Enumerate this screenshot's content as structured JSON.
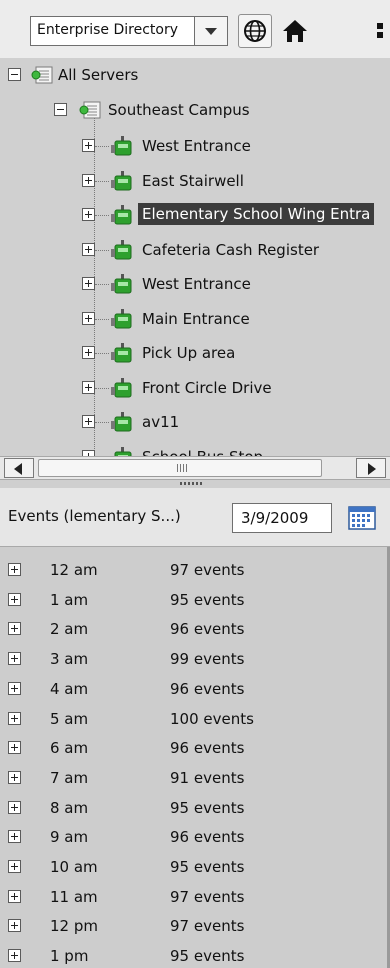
{
  "toolbar": {
    "directory_value": "Enterprise Directory",
    "icons": [
      "globe-icon",
      "home-icon",
      "grid-icon"
    ]
  },
  "tree": {
    "root": {
      "label": "All Servers",
      "icon": "server-group-icon",
      "expanded": true
    },
    "site": {
      "label": "Southeast Campus",
      "icon": "server-icon",
      "expanded": true
    },
    "cameras": [
      {
        "label": "West Entrance",
        "selected": false
      },
      {
        "label": "East Stairwell",
        "selected": false
      },
      {
        "label": "Elementary School Wing Entra",
        "selected": true
      },
      {
        "label": "Cafeteria Cash Register",
        "selected": false
      },
      {
        "label": "West Entrance",
        "selected": false
      },
      {
        "label": "Main Entrance",
        "selected": false
      },
      {
        "label": "Pick Up area",
        "selected": false
      },
      {
        "label": "Front Circle Drive",
        "selected": false
      },
      {
        "label": "av11",
        "selected": false
      },
      {
        "label": "School Bus Stop",
        "selected": false
      }
    ]
  },
  "events": {
    "title": "Events (lementary S...)",
    "date": "3/9/2009",
    "rows": [
      {
        "time": "12 am",
        "count": "97 events"
      },
      {
        "time": "1 am",
        "count": "95 events"
      },
      {
        "time": "2 am",
        "count": "96 events"
      },
      {
        "time": "3 am",
        "count": "99 events"
      },
      {
        "time": "4 am",
        "count": "96 events"
      },
      {
        "time": "5 am",
        "count": "100 events"
      },
      {
        "time": "6 am",
        "count": "96 events"
      },
      {
        "time": "7 am",
        "count": "91 events"
      },
      {
        "time": "8 am",
        "count": "95 events"
      },
      {
        "time": "9 am",
        "count": "96 events"
      },
      {
        "time": "10 am",
        "count": "95 events"
      },
      {
        "time": "11 am",
        "count": "97 events"
      },
      {
        "time": "12 pm",
        "count": "97 events"
      },
      {
        "time": "1 pm",
        "count": "95 events"
      }
    ]
  },
  "colors": {
    "selection_bg": "#3c3c3c",
    "camera_green": "#2ea02e",
    "panel_bg": "#d0d0d0"
  }
}
